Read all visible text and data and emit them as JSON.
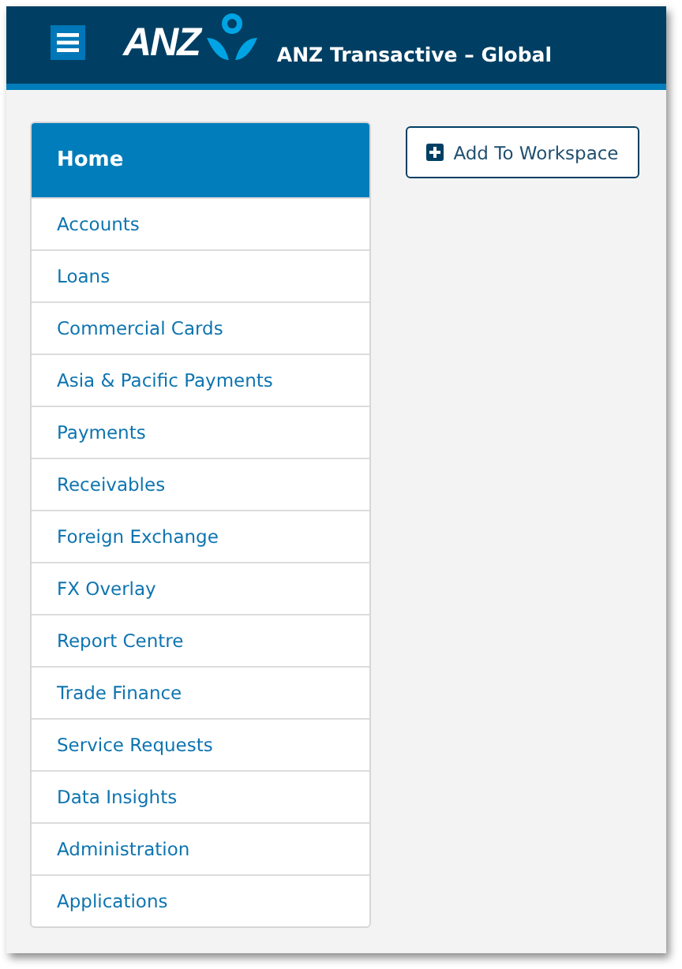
{
  "header": {
    "logo": "ANZ",
    "title": "ANZ Transactive – Global"
  },
  "sidebar": {
    "items": [
      {
        "label": "Home",
        "selected": true
      },
      {
        "label": "Accounts",
        "selected": false
      },
      {
        "label": "Loans",
        "selected": false
      },
      {
        "label": "Commercial Cards",
        "selected": false
      },
      {
        "label": "Asia & Pacific Payments",
        "selected": false
      },
      {
        "label": "Payments",
        "selected": false
      },
      {
        "label": "Receivables",
        "selected": false
      },
      {
        "label": "Foreign Exchange",
        "selected": false
      },
      {
        "label": "FX Overlay",
        "selected": false
      },
      {
        "label": "Report Centre",
        "selected": false
      },
      {
        "label": "Trade Finance",
        "selected": false
      },
      {
        "label": "Service Requests",
        "selected": false
      },
      {
        "label": "Data Insights",
        "selected": false
      },
      {
        "label": "Administration",
        "selected": false
      },
      {
        "label": "Applications",
        "selected": false
      }
    ]
  },
  "workspace_button": {
    "label": "Add To Workspace"
  }
}
